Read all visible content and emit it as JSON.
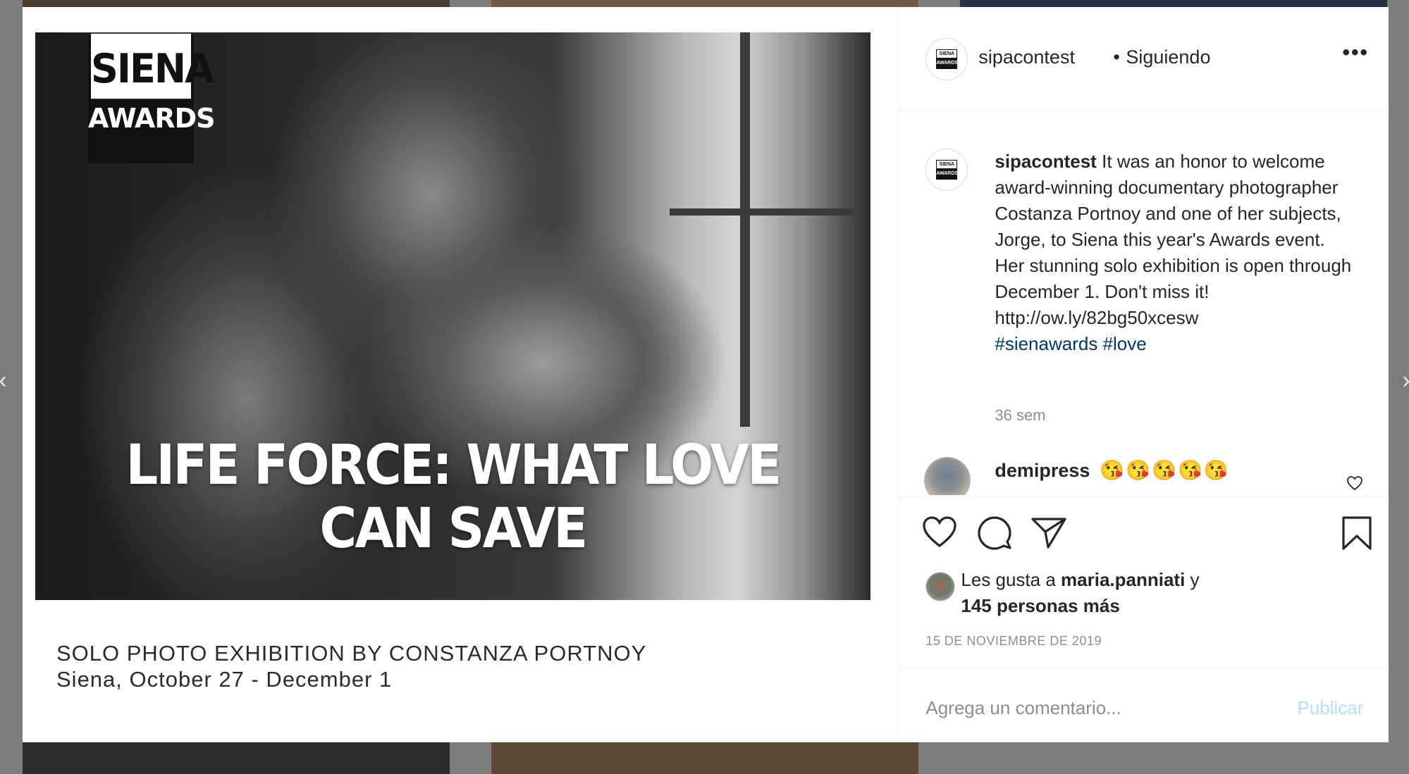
{
  "header": {
    "username": "sipacontest",
    "separator": "•",
    "follow_status": "Siguiendo",
    "more_label": "•••"
  },
  "media": {
    "logo_top": "SIENA",
    "logo_bottom": "AWARDS",
    "headline": "LIFE FORCE: WHAT LOVE CAN SAVE",
    "caption_line1": "SOLO PHOTO EXHIBITION BY CONSTANZA PORTNOY",
    "caption_line2": "Siena, October 27 - December 1"
  },
  "caption": {
    "username": "sipacontest",
    "text": "It was an honor to welcome award-winning documentary photographer Costanza Portnoy and one of her subjects, Jorge, to Siena this year's Awards event. Her stunning solo exhibition is open through December 1. Don't miss it! http://ow.ly/82bg50xcesw",
    "hashtags": "#sienawards #love",
    "time_ago": "36 sem"
  },
  "comment": {
    "username": "demipress",
    "text": "😘😘😘😘😘"
  },
  "likes": {
    "prefix": "Les gusta a",
    "user": "maria.panniati",
    "suffix": "y",
    "others": "145 personas más"
  },
  "date": "15 DE NOVIEMBRE DE 2019",
  "add_comment": {
    "placeholder": "Agrega un comentario...",
    "publish_label": "Publicar"
  },
  "icons": [
    "heart-icon",
    "comment-icon",
    "share-icon",
    "bookmark-icon",
    "more-icon"
  ],
  "colors": {
    "hashtag": "#00376b",
    "publish_disabled": "#b2dffc",
    "muted": "#8e8e8e",
    "text": "#262626"
  }
}
